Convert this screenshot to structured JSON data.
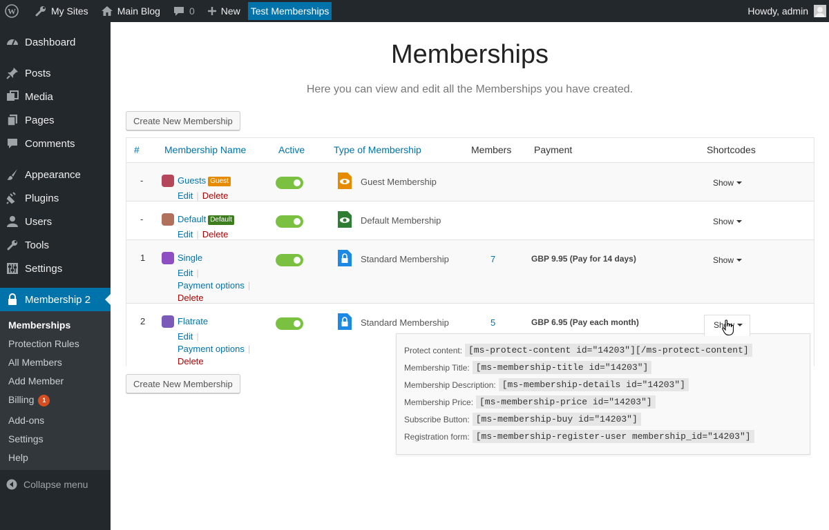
{
  "admin_bar": {
    "my_sites": "My Sites",
    "site_name": "Main Blog",
    "comments_count": "0",
    "new_label": "New",
    "current_site": "Test Memberships",
    "howdy": "Howdy, admin"
  },
  "sidebar": {
    "items": [
      {
        "label": "Dashboard",
        "icon": "dashboard-icon"
      },
      {
        "label": "Posts",
        "icon": "pin-icon"
      },
      {
        "label": "Media",
        "icon": "media-icon"
      },
      {
        "label": "Pages",
        "icon": "pages-icon"
      },
      {
        "label": "Comments",
        "icon": "comment-icon"
      },
      {
        "label": "Appearance",
        "icon": "brush-icon"
      },
      {
        "label": "Plugins",
        "icon": "plug-icon"
      },
      {
        "label": "Users",
        "icon": "user-icon"
      },
      {
        "label": "Tools",
        "icon": "wrench-icon"
      },
      {
        "label": "Settings",
        "icon": "sliders-icon"
      },
      {
        "label": "Membership 2",
        "icon": "lock-icon"
      }
    ],
    "submenu": [
      {
        "label": "Memberships"
      },
      {
        "label": "Protection Rules"
      },
      {
        "label": "All Members"
      },
      {
        "label": "Add Member"
      },
      {
        "label": "Billing",
        "badge": "1"
      },
      {
        "label": "Add-ons"
      },
      {
        "label": "Settings"
      },
      {
        "label": "Help"
      }
    ],
    "collapse": "Collapse menu"
  },
  "page": {
    "title": "Memberships",
    "description": "Here you can view and edit all the Memberships you have created.",
    "create_button": "Create New Membership"
  },
  "table": {
    "headers": {
      "num": "#",
      "name": "Membership Name",
      "active": "Active",
      "type": "Type of Membership",
      "members": "Members",
      "payment": "Payment",
      "shortcodes": "Shortcodes"
    },
    "rows": [
      {
        "num": "-",
        "name": "Guests",
        "tag": "Guest",
        "type": "Guest Membership",
        "members": "",
        "payment": "",
        "show": "Show",
        "edit": "Edit",
        "delete": "Delete",
        "payment_options": ""
      },
      {
        "num": "-",
        "name": "Default",
        "tag": "Default",
        "type": "Default Membership",
        "members": "",
        "payment": "",
        "show": "Show",
        "edit": "Edit",
        "delete": "Delete",
        "payment_options": ""
      },
      {
        "num": "1",
        "name": "Single",
        "tag": "",
        "type": "Standard Membership",
        "members": "7",
        "payment": "GBP 9.95 (Pay for 14 days)",
        "show": "Show",
        "edit": "Edit",
        "delete": "Delete",
        "payment_options": "Payment options"
      },
      {
        "num": "2",
        "name": "Flatrate",
        "tag": "",
        "type": "Standard Membership",
        "members": "5",
        "payment": "GBP 6.95 (Pay each month)",
        "show": "Show",
        "edit": "Edit",
        "delete": "Delete",
        "payment_options": "Payment options"
      }
    ]
  },
  "shortcodes": [
    {
      "label": "Protect content:",
      "code": "[ms-protect-content id=\"14203\"][/ms-protect-content]"
    },
    {
      "label": "Membership Title:",
      "code": "[ms-membership-title id=\"14203\"]"
    },
    {
      "label": "Membership Description:",
      "code": "[ms-membership-details id=\"14203\"]"
    },
    {
      "label": "Membership Price:",
      "code": "[ms-membership-price id=\"14203\"]"
    },
    {
      "label": "Subscribe Button:",
      "code": "[ms-membership-buy id=\"14203\"]"
    },
    {
      "label": "Registration form:",
      "code": "[ms-membership-register-user membership_id=\"14203\"]"
    }
  ],
  "colors": {
    "accent": "#0073aa",
    "toggle_on": "#7ac142",
    "guest_tag": "#e68a00",
    "default_tag": "#3e7d1e",
    "delete": "#aa0000"
  }
}
